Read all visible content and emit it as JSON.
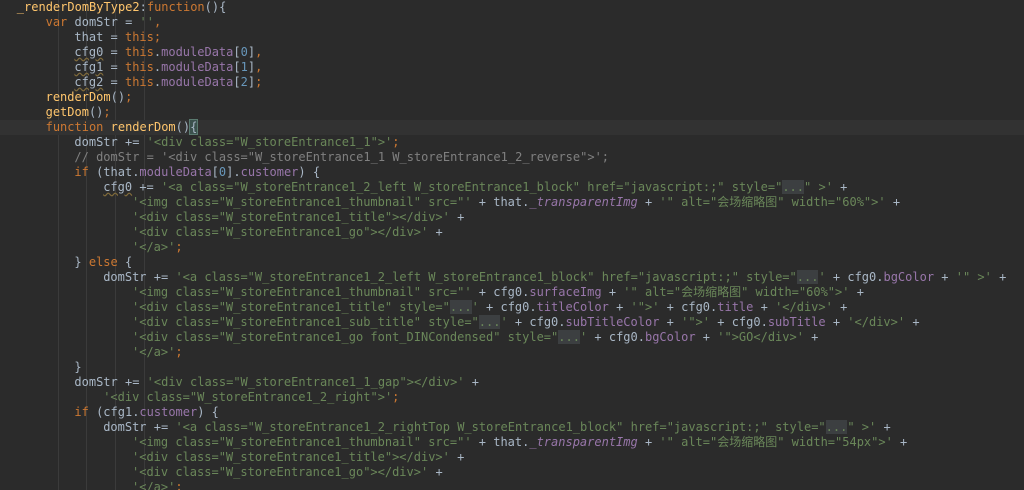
{
  "editor": {
    "language": "javascript",
    "theme": "darcula",
    "current_line": 8,
    "lines": [
      {
        "indent": 4,
        "tokens": [
          {
            "t": "_renderDomByType2",
            "c": "fn"
          },
          {
            "t": ":"
          },
          {
            "t": "function",
            "c": "kw"
          },
          {
            "t": "(){"
          }
        ]
      },
      {
        "indent": 8,
        "tokens": [
          {
            "t": "var",
            "c": "kw"
          },
          {
            "t": " domStr = "
          },
          {
            "t": "''",
            "c": "str"
          },
          {
            "t": ",",
            "c": "kw"
          }
        ]
      },
      {
        "indent": 12,
        "tokens": [
          {
            "t": "that = "
          },
          {
            "t": "this",
            "c": "kw"
          },
          {
            "t": ";",
            "c": "kw"
          }
        ]
      },
      {
        "indent": 12,
        "tokens": [
          {
            "t": "cfg0",
            "c": "uvar"
          },
          {
            "t": " = "
          },
          {
            "t": "this",
            "c": "kw"
          },
          {
            "t": "."
          },
          {
            "t": "moduleData",
            "c": "fld"
          },
          {
            "t": "["
          },
          {
            "t": "0",
            "c": "num"
          },
          {
            "t": "]"
          },
          {
            "t": ",",
            "c": "kw"
          }
        ]
      },
      {
        "indent": 12,
        "tokens": [
          {
            "t": "cfg1",
            "c": "uvar"
          },
          {
            "t": " = "
          },
          {
            "t": "this",
            "c": "kw"
          },
          {
            "t": "."
          },
          {
            "t": "moduleData",
            "c": "fld"
          },
          {
            "t": "["
          },
          {
            "t": "1",
            "c": "num"
          },
          {
            "t": "]"
          },
          {
            "t": ",",
            "c": "kw"
          }
        ]
      },
      {
        "indent": 12,
        "tokens": [
          {
            "t": "cfg2",
            "c": "uvar"
          },
          {
            "t": " = "
          },
          {
            "t": "this",
            "c": "kw"
          },
          {
            "t": "."
          },
          {
            "t": "moduleData",
            "c": "fld"
          },
          {
            "t": "["
          },
          {
            "t": "2",
            "c": "num"
          },
          {
            "t": "]"
          },
          {
            "t": ";",
            "c": "kw"
          }
        ]
      },
      {
        "indent": 8,
        "tokens": [
          {
            "t": "renderDom",
            "c": "fn"
          },
          {
            "t": "()"
          },
          {
            "t": ";",
            "c": "kw"
          }
        ]
      },
      {
        "indent": 8,
        "tokens": [
          {
            "t": "getDom",
            "c": "fn"
          },
          {
            "t": "()"
          },
          {
            "t": ";",
            "c": "kw"
          }
        ]
      },
      {
        "indent": 8,
        "tokens": [
          {
            "t": "function",
            "c": "kw"
          },
          {
            "t": " "
          },
          {
            "t": "renderDom",
            "c": "fn"
          },
          {
            "t": "()"
          },
          {
            "t": "{",
            "c": "br"
          }
        ]
      },
      {
        "indent": 12,
        "tokens": [
          {
            "t": "domStr += "
          },
          {
            "t": "'<div class=\"W_storeEntrance1_1\">'",
            "c": "str"
          },
          {
            "t": ";",
            "c": "kw"
          }
        ]
      },
      {
        "indent": 12,
        "tokens": [
          {
            "t": "// domStr = '<div class=\"W_storeEntrance1_1 W_storeEntrance1_2_reverse\">';",
            "c": "cm"
          }
        ]
      },
      {
        "indent": 12,
        "tokens": [
          {
            "t": "if",
            "c": "kw"
          },
          {
            "t": " (that."
          },
          {
            "t": "moduleData",
            "c": "fld"
          },
          {
            "t": "["
          },
          {
            "t": "0",
            "c": "num"
          },
          {
            "t": "]."
          },
          {
            "t": "customer",
            "c": "fld"
          },
          {
            "t": ") {"
          }
        ]
      },
      {
        "indent": 16,
        "tokens": [
          {
            "t": "cfg0",
            "c": "uvar"
          },
          {
            "t": " += "
          },
          {
            "t": "'<a class=\"W_storeEntrance1_2_left W_storeEntrance1_block\" href=\"javascript:;\" style=\"",
            "c": "str"
          },
          {
            "t": "...",
            "c": "fold"
          },
          {
            "t": "\" >'",
            "c": "str"
          },
          {
            "t": " +"
          }
        ]
      },
      {
        "indent": 20,
        "tokens": [
          {
            "t": "'<img class=\"W_storeEntrance1_thumbnail\" src=\"'",
            "c": "str"
          },
          {
            "t": " + that."
          },
          {
            "t": "_transparentImg",
            "c": "it"
          },
          {
            "t": " + "
          },
          {
            "t": "'\" alt=\"会场缩略图\" width=\"60%\">'",
            "c": "str"
          },
          {
            "t": " +"
          }
        ]
      },
      {
        "indent": 20,
        "tokens": [
          {
            "t": "'<div class=\"W_storeEntrance1_title\"></div>'",
            "c": "str"
          },
          {
            "t": " +"
          }
        ]
      },
      {
        "indent": 20,
        "tokens": [
          {
            "t": "'<div class=\"W_storeEntrance1_go\"></div>'",
            "c": "str"
          },
          {
            "t": " +"
          }
        ]
      },
      {
        "indent": 20,
        "tokens": [
          {
            "t": "'</a>'",
            "c": "str"
          },
          {
            "t": ";",
            "c": "kw"
          }
        ]
      },
      {
        "indent": 12,
        "tokens": [
          {
            "t": "} "
          },
          {
            "t": "else",
            "c": "kw"
          },
          {
            "t": " {"
          }
        ]
      },
      {
        "indent": 16,
        "tokens": [
          {
            "t": "domStr += "
          },
          {
            "t": "'<a class=\"W_storeEntrance1_2_left W_storeEntrance1_block\" href=\"javascript:;\" style=\"",
            "c": "str"
          },
          {
            "t": "...",
            "c": "fold"
          },
          {
            "t": "'",
            "c": "str"
          },
          {
            "t": " + cfg0."
          },
          {
            "t": "bgColor",
            "c": "fld"
          },
          {
            "t": " + "
          },
          {
            "t": "'\" >'",
            "c": "str"
          },
          {
            "t": " +"
          }
        ]
      },
      {
        "indent": 20,
        "tokens": [
          {
            "t": "'<img class=\"W_storeEntrance1_thumbnail\" src=\"'",
            "c": "str"
          },
          {
            "t": " + cfg0."
          },
          {
            "t": "surfaceImg",
            "c": "fld"
          },
          {
            "t": " + "
          },
          {
            "t": "'\" alt=\"会场缩略图\" width=\"60%\">'",
            "c": "str"
          },
          {
            "t": " +"
          }
        ]
      },
      {
        "indent": 20,
        "tokens": [
          {
            "t": "'<div class=\"W_storeEntrance1_title\" style=\"",
            "c": "str"
          },
          {
            "t": "...",
            "c": "fold"
          },
          {
            "t": "'",
            "c": "str"
          },
          {
            "t": " + cfg0."
          },
          {
            "t": "titleColor",
            "c": "fld"
          },
          {
            "t": " + "
          },
          {
            "t": "'\">'",
            "c": "str"
          },
          {
            "t": " + cfg0."
          },
          {
            "t": "title",
            "c": "fld"
          },
          {
            "t": " + "
          },
          {
            "t": "'</div>'",
            "c": "str"
          },
          {
            "t": " +"
          }
        ]
      },
      {
        "indent": 20,
        "tokens": [
          {
            "t": "'<div class=\"W_storeEntrance1_sub_title\" style=\"",
            "c": "str"
          },
          {
            "t": "...",
            "c": "fold"
          },
          {
            "t": "'",
            "c": "str"
          },
          {
            "t": " + cfg0."
          },
          {
            "t": "subTitleColor",
            "c": "fld"
          },
          {
            "t": " + "
          },
          {
            "t": "'\">'",
            "c": "str"
          },
          {
            "t": " + cfg0."
          },
          {
            "t": "subTitle",
            "c": "fld"
          },
          {
            "t": " + "
          },
          {
            "t": "'</div>'",
            "c": "str"
          },
          {
            "t": " +"
          }
        ]
      },
      {
        "indent": 20,
        "tokens": [
          {
            "t": "'<div class=\"W_storeEntrance1_go font_DINCondensed\" style=\"",
            "c": "str"
          },
          {
            "t": "...",
            "c": "fold"
          },
          {
            "t": "'",
            "c": "str"
          },
          {
            "t": " + cfg0."
          },
          {
            "t": "bgColor",
            "c": "fld"
          },
          {
            "t": " + "
          },
          {
            "t": "'\">GO</div>'",
            "c": "str"
          },
          {
            "t": " +"
          }
        ]
      },
      {
        "indent": 20,
        "tokens": [
          {
            "t": "'</a>'",
            "c": "str"
          },
          {
            "t": ";",
            "c": "kw"
          }
        ]
      },
      {
        "indent": 12,
        "tokens": [
          {
            "t": "}"
          }
        ]
      },
      {
        "indent": 12,
        "tokens": [
          {
            "t": "domStr += "
          },
          {
            "t": "'<div class=\"W_storeEntrance1_1_gap\"></div>'",
            "c": "str"
          },
          {
            "t": " +"
          }
        ]
      },
      {
        "indent": 16,
        "tokens": [
          {
            "t": "'<div class=\"W_storeEntrance1_2_right\">'",
            "c": "str"
          },
          {
            "t": ";",
            "c": "kw"
          }
        ]
      },
      {
        "indent": 12,
        "tokens": [
          {
            "t": "if",
            "c": "kw"
          },
          {
            "t": " (cfg1."
          },
          {
            "t": "customer",
            "c": "fld"
          },
          {
            "t": ") {"
          }
        ]
      },
      {
        "indent": 16,
        "tokens": [
          {
            "t": "domStr += "
          },
          {
            "t": "'<a class=\"W_storeEntrance1_2_rightTop W_storeEntrance1_block\" href=\"javascript:;\" style=\"",
            "c": "str"
          },
          {
            "t": "...",
            "c": "fold"
          },
          {
            "t": "\" >'",
            "c": "str"
          },
          {
            "t": " +"
          }
        ]
      },
      {
        "indent": 20,
        "tokens": [
          {
            "t": "'<img class=\"W_storeEntrance1_thumbnail\" src=\"'",
            "c": "str"
          },
          {
            "t": " + that."
          },
          {
            "t": "_transparentImg",
            "c": "it"
          },
          {
            "t": " + "
          },
          {
            "t": "'\" alt=\"会场缩略图\" width=\"54px\">'",
            "c": "str"
          },
          {
            "t": " +"
          }
        ]
      },
      {
        "indent": 20,
        "tokens": [
          {
            "t": "'<div class=\"W_storeEntrance1_title\"></div>'",
            "c": "str"
          },
          {
            "t": " +"
          }
        ]
      },
      {
        "indent": 20,
        "tokens": [
          {
            "t": "'<div class=\"W_storeEntrance1_go\"></div>'",
            "c": "str"
          },
          {
            "t": " +"
          }
        ]
      },
      {
        "indent": 20,
        "tokens": [
          {
            "t": "'</a>'",
            "c": "str"
          },
          {
            "t": ";",
            "c": "kw"
          }
        ]
      }
    ]
  }
}
